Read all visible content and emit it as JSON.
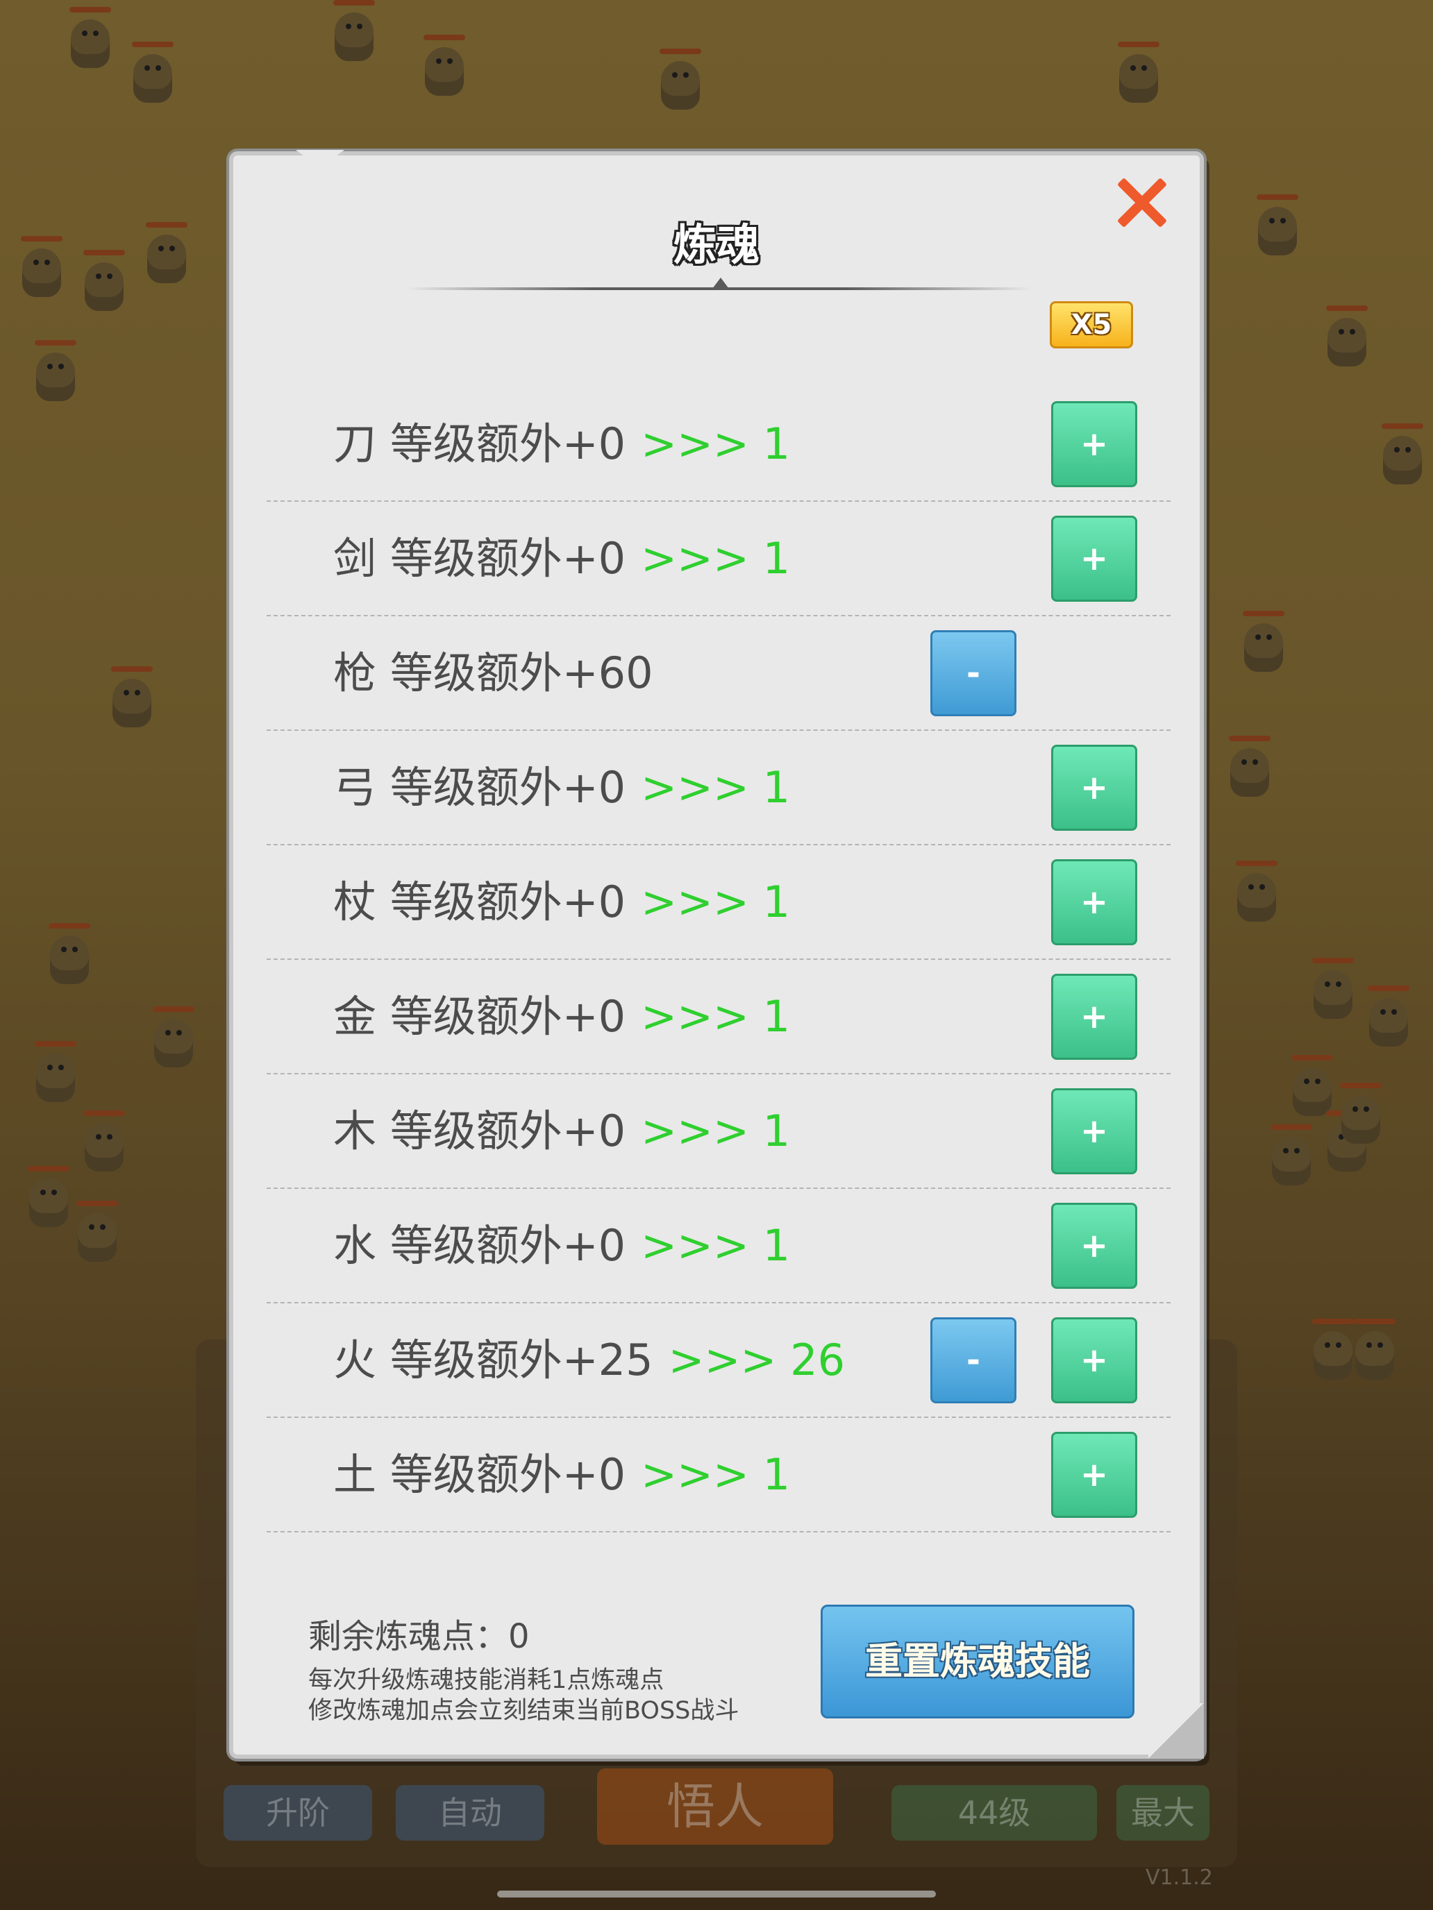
{
  "dialog": {
    "title": "炼魂",
    "multiplier": "X5",
    "rows": [
      {
        "label": "刀 等级额外+0",
        "arrow": ">>> 1",
        "plus": true,
        "minus": false
      },
      {
        "label": "剑 等级额外+0",
        "arrow": ">>> 1",
        "plus": true,
        "minus": false
      },
      {
        "label": "枪 等级额外+60",
        "arrow": "",
        "plus": false,
        "minus": true
      },
      {
        "label": "弓 等级额外+0",
        "arrow": ">>> 1",
        "plus": true,
        "minus": false
      },
      {
        "label": "杖 等级额外+0",
        "arrow": ">>> 1",
        "plus": true,
        "minus": false
      },
      {
        "label": "金 等级额外+0",
        "arrow": ">>> 1",
        "plus": true,
        "minus": false
      },
      {
        "label": "木 等级额外+0",
        "arrow": ">>> 1",
        "plus": true,
        "minus": false
      },
      {
        "label": "水 等级额外+0",
        "arrow": ">>> 1",
        "plus": true,
        "minus": false
      },
      {
        "label": "火 等级额外+25",
        "arrow": ">>> 26",
        "plus": true,
        "minus": true
      },
      {
        "label": "土 等级额外+0",
        "arrow": ">>> 1",
        "plus": true,
        "minus": false
      }
    ],
    "plus_label": "+",
    "minus_label": "-",
    "remaining": "剩余炼魂点：0",
    "note1": "每次升级炼魂技能消耗1点炼魂点",
    "note2": "修改炼魂加点会立刻结束当前BOSS战斗",
    "reset_label": "重置炼魂技能"
  },
  "background": {
    "bottom_buttons": [
      "升阶",
      "自动",
      "悟人",
      "44级",
      "最大"
    ],
    "version": "V1.1.2"
  },
  "colors": {
    "arrow_green": "#2fcf2f",
    "plus_green": "#3cc089",
    "minus_blue": "#3f9bd4",
    "close_orange": "#ee5a2c",
    "x5_gold": "#f7b21c"
  }
}
